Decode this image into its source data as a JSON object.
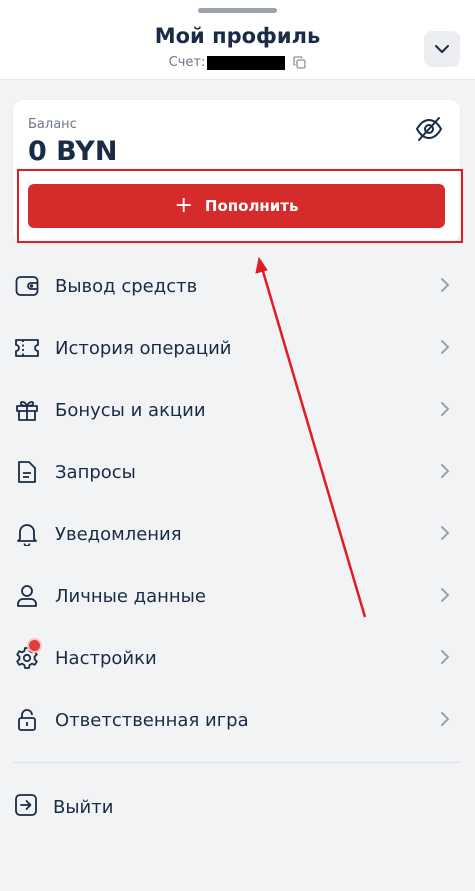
{
  "header": {
    "title": "Мой профиль",
    "account_label": "Счет:"
  },
  "balance": {
    "label": "Баланс",
    "value": "0 BYN",
    "topup_label": "Пополнить"
  },
  "menu": {
    "items": [
      {
        "label": "Вывод средств",
        "icon": "wallet-icon"
      },
      {
        "label": "История операций",
        "icon": "ticket-icon"
      },
      {
        "label": "Бонусы и акции",
        "icon": "gift-icon"
      },
      {
        "label": "Запросы",
        "icon": "document-icon"
      },
      {
        "label": "Уведомления",
        "icon": "bell-icon"
      },
      {
        "label": "Личные данные",
        "icon": "user-icon"
      },
      {
        "label": "Настройки",
        "icon": "gear-icon"
      },
      {
        "label": "Ответственная игра",
        "icon": "lock-icon"
      }
    ],
    "logout_label": "Выйти"
  },
  "colors": {
    "accent": "#d62b2b",
    "annotation": "#e31b23",
    "text": "#1a2b45",
    "background": "#f2f3f5"
  }
}
